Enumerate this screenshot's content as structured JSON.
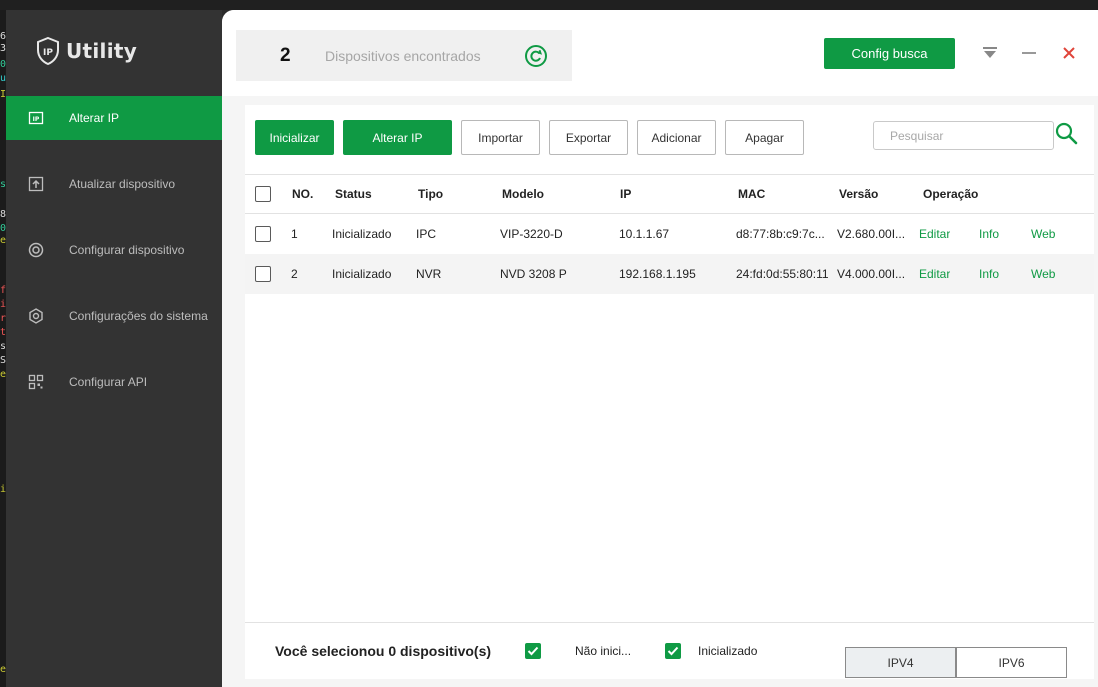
{
  "app": {
    "name": "Utility",
    "logo_mark": "IP"
  },
  "sidebar": {
    "items": [
      {
        "label": "Alterar IP",
        "icon": "ip-card-icon",
        "active": true
      },
      {
        "label": "Atualizar dispositivo",
        "icon": "upload-box-icon",
        "active": false
      },
      {
        "label": "Configurar dispositivo",
        "icon": "target-circle-icon",
        "active": false
      },
      {
        "label": "Configurações do sistema",
        "icon": "hexagon-gear-icon",
        "active": false
      },
      {
        "label": "Configurar API",
        "icon": "qr-grid-icon",
        "active": false
      }
    ]
  },
  "header": {
    "count": "2",
    "count_label": "Dispositivos encontrados",
    "config_button": "Config busca"
  },
  "toolbar": {
    "initialize": "Inicializar",
    "change_ip": "Alterar IP",
    "import": "Importar",
    "export": "Exportar",
    "add": "Adicionar",
    "delete": "Apagar",
    "search_placeholder": "Pesquisar"
  },
  "table": {
    "columns": [
      "NO.",
      "Status",
      "Tipo",
      "Modelo",
      "IP",
      "MAC",
      "Versão",
      "Operação"
    ],
    "rows": [
      {
        "no": "1",
        "status": "Inicializado",
        "type": "IPC",
        "model": "VIP-3220-D",
        "ip": "10.1.1.67",
        "mac": "d8:77:8b:c9:7c...",
        "version": "V2.680.00I...",
        "ops": [
          "Editar",
          "Info",
          "Web"
        ]
      },
      {
        "no": "2",
        "status": "Inicializado",
        "type": "NVR",
        "model": "NVD 3208 P",
        "ip": "192.168.1.195",
        "mac": "24:fd:0d:55:80:11",
        "version": "V4.000.00I...",
        "ops": [
          "Editar",
          "Info",
          "Web"
        ]
      }
    ]
  },
  "footer": {
    "selected_text": "Você selecionou 0 dispositivo(s)",
    "filter_uninit": "Não inici...",
    "filter_init": "Inicializado",
    "ipv4": "IPV4",
    "ipv6": "IPV6"
  },
  "colors": {
    "accent": "#0f9a44",
    "sidebar_bg": "#333333",
    "close_red": "#e0443a"
  }
}
